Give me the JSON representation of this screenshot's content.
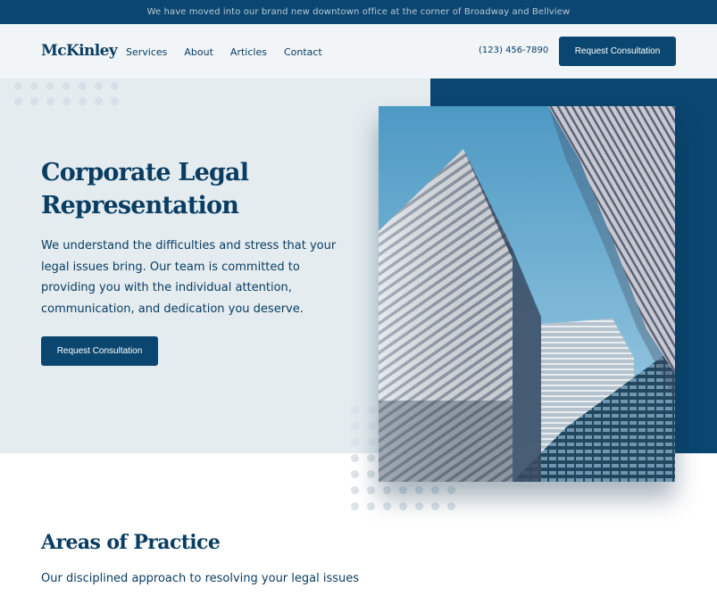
{
  "announcement": "We have moved into our brand new downtown office at the corner of Broadway and Bellview",
  "header": {
    "logo": "McKinley",
    "nav": [
      {
        "label": "Services"
      },
      {
        "label": "About"
      },
      {
        "label": "Articles"
      },
      {
        "label": "Contact"
      }
    ],
    "phone": "(123) 456-7890",
    "cta_label": "Request Consultation"
  },
  "hero": {
    "title": "Corporate Legal Representation",
    "description": "We understand the difficulties and stress that your legal issues bring. Our team is committed to providing you with the individual attention, communication, and dedication you deserve.",
    "cta_label": "Request Consultation",
    "image": "skyscrapers-photo"
  },
  "practice": {
    "title": "Areas of Practice",
    "subtitle": "Our disciplined approach to resolving your legal issues"
  },
  "colors": {
    "navy": "#0a4670",
    "text": "#0a3d62",
    "hero_bg": "#e4ecf0",
    "nav_bg": "#f2f5f7"
  }
}
